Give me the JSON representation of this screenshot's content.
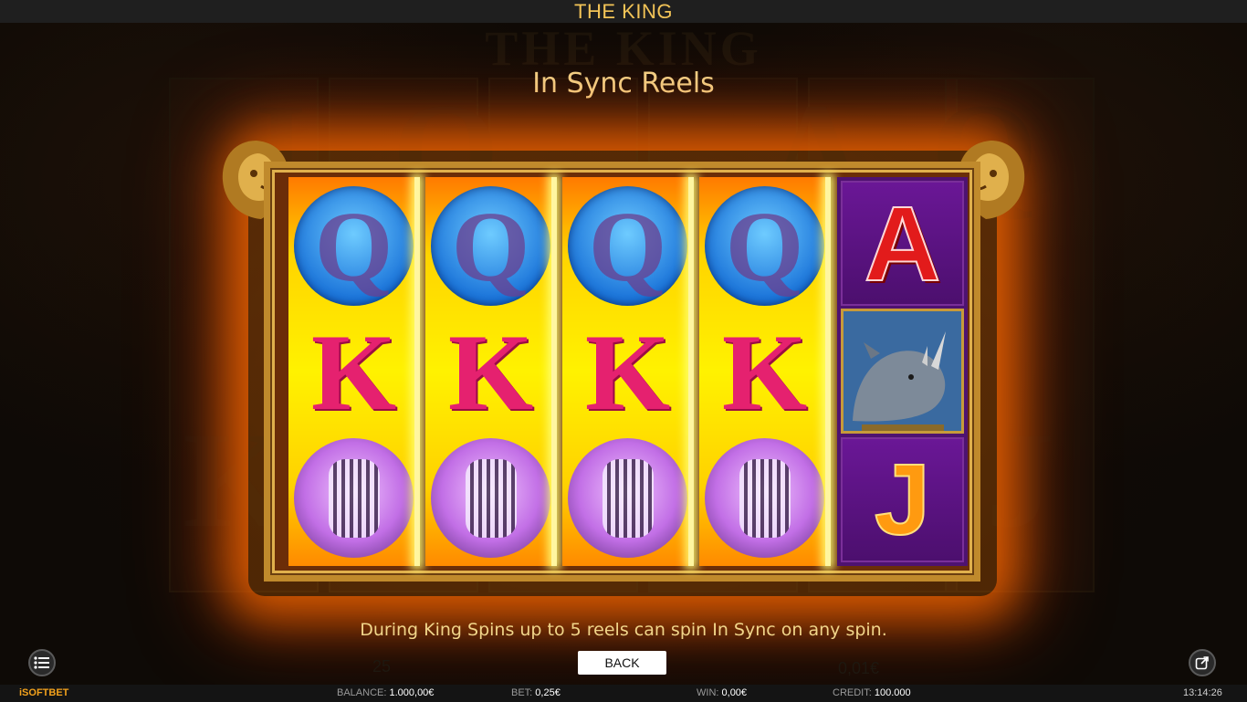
{
  "window": {
    "title": "THE KING"
  },
  "background": {
    "title": "THE KING"
  },
  "info": {
    "heading": "In Sync Reels",
    "description": "During King Spins up to 5 reels can spin In Sync on any spin.",
    "back_label": "BACK"
  },
  "reels": {
    "sync_columns": 4,
    "sync_symbols": [
      "Q",
      "K",
      "zebra"
    ],
    "column5_symbols": [
      "A",
      "rhino",
      "J"
    ]
  },
  "symbols": {
    "q": "Q",
    "k": "K",
    "a": "A",
    "j": "J"
  },
  "statusbar": {
    "logo": "iSOFTBET",
    "balance_label": "BALANCE:",
    "balance_value": "1.000,00€",
    "bet_label": "BET:",
    "bet_value": "0,25€",
    "win_label": "WIN:",
    "win_value": "0,00€",
    "credit_label": "CREDIT:",
    "credit_value": "100.000",
    "clock": "13:14:26"
  },
  "icons": {
    "menu": "menu-list-icon",
    "popout": "external-window-icon"
  },
  "colors": {
    "accent_gold": "#f1d58a",
    "title_gold": "#f3c457",
    "sync_reel_yellow": "#fff200"
  }
}
